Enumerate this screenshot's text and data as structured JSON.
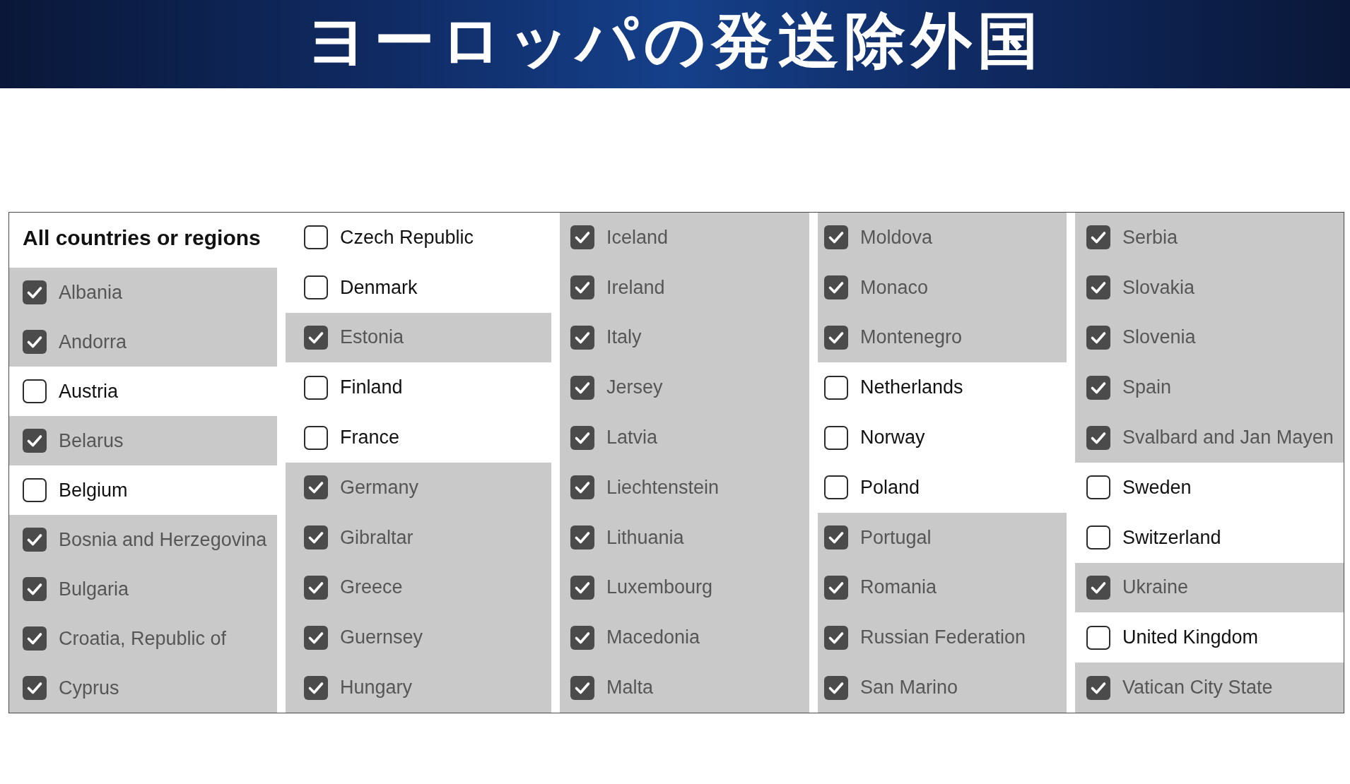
{
  "banner": {
    "title": "ヨーロッパの発送除外国"
  },
  "region_panel": {
    "columns": [
      {
        "heading": "All countries or regions",
        "items": [
          {
            "name": "Albania",
            "checked": true
          },
          {
            "name": "Andorra",
            "checked": true
          },
          {
            "name": "Austria",
            "checked": false
          },
          {
            "name": "Belarus",
            "checked": true
          },
          {
            "name": "Belgium",
            "checked": false
          },
          {
            "name": "Bosnia and Herzegovina",
            "checked": true
          },
          {
            "name": "Bulgaria",
            "checked": true
          },
          {
            "name": "Croatia, Republic of",
            "checked": true
          },
          {
            "name": "Cyprus",
            "checked": true
          }
        ]
      },
      {
        "items": [
          {
            "name": "Czech Republic",
            "checked": false
          },
          {
            "name": "Denmark",
            "checked": false
          },
          {
            "name": "Estonia",
            "checked": true
          },
          {
            "name": "Finland",
            "checked": false
          },
          {
            "name": "France",
            "checked": false
          },
          {
            "name": "Germany",
            "checked": true
          },
          {
            "name": "Gibraltar",
            "checked": true
          },
          {
            "name": "Greece",
            "checked": true
          },
          {
            "name": "Guernsey",
            "checked": true
          },
          {
            "name": "Hungary",
            "checked": true
          }
        ]
      },
      {
        "items": [
          {
            "name": "Iceland",
            "checked": true
          },
          {
            "name": "Ireland",
            "checked": true
          },
          {
            "name": "Italy",
            "checked": true
          },
          {
            "name": "Jersey",
            "checked": true
          },
          {
            "name": "Latvia",
            "checked": true
          },
          {
            "name": "Liechtenstein",
            "checked": true
          },
          {
            "name": "Lithuania",
            "checked": true
          },
          {
            "name": "Luxembourg",
            "checked": true
          },
          {
            "name": "Macedonia",
            "checked": true
          },
          {
            "name": "Malta",
            "checked": true
          }
        ]
      },
      {
        "items": [
          {
            "name": "Moldova",
            "checked": true
          },
          {
            "name": "Monaco",
            "checked": true
          },
          {
            "name": "Montenegro",
            "checked": true
          },
          {
            "name": "Netherlands",
            "checked": false
          },
          {
            "name": "Norway",
            "checked": false
          },
          {
            "name": "Poland",
            "checked": false
          },
          {
            "name": "Portugal",
            "checked": true
          },
          {
            "name": "Romania",
            "checked": true
          },
          {
            "name": "Russian Federation",
            "checked": true
          },
          {
            "name": "San Marino",
            "checked": true
          }
        ]
      },
      {
        "items": [
          {
            "name": "Serbia",
            "checked": true
          },
          {
            "name": "Slovakia",
            "checked": true
          },
          {
            "name": "Slovenia",
            "checked": true
          },
          {
            "name": "Spain",
            "checked": true
          },
          {
            "name": "Svalbard and Jan Mayen",
            "checked": true
          },
          {
            "name": "Sweden",
            "checked": false
          },
          {
            "name": "Switzerland",
            "checked": false
          },
          {
            "name": "Ukraine",
            "checked": true
          },
          {
            "name": "United Kingdom",
            "checked": false
          },
          {
            "name": "Vatican City State",
            "checked": true
          }
        ]
      }
    ]
  }
}
